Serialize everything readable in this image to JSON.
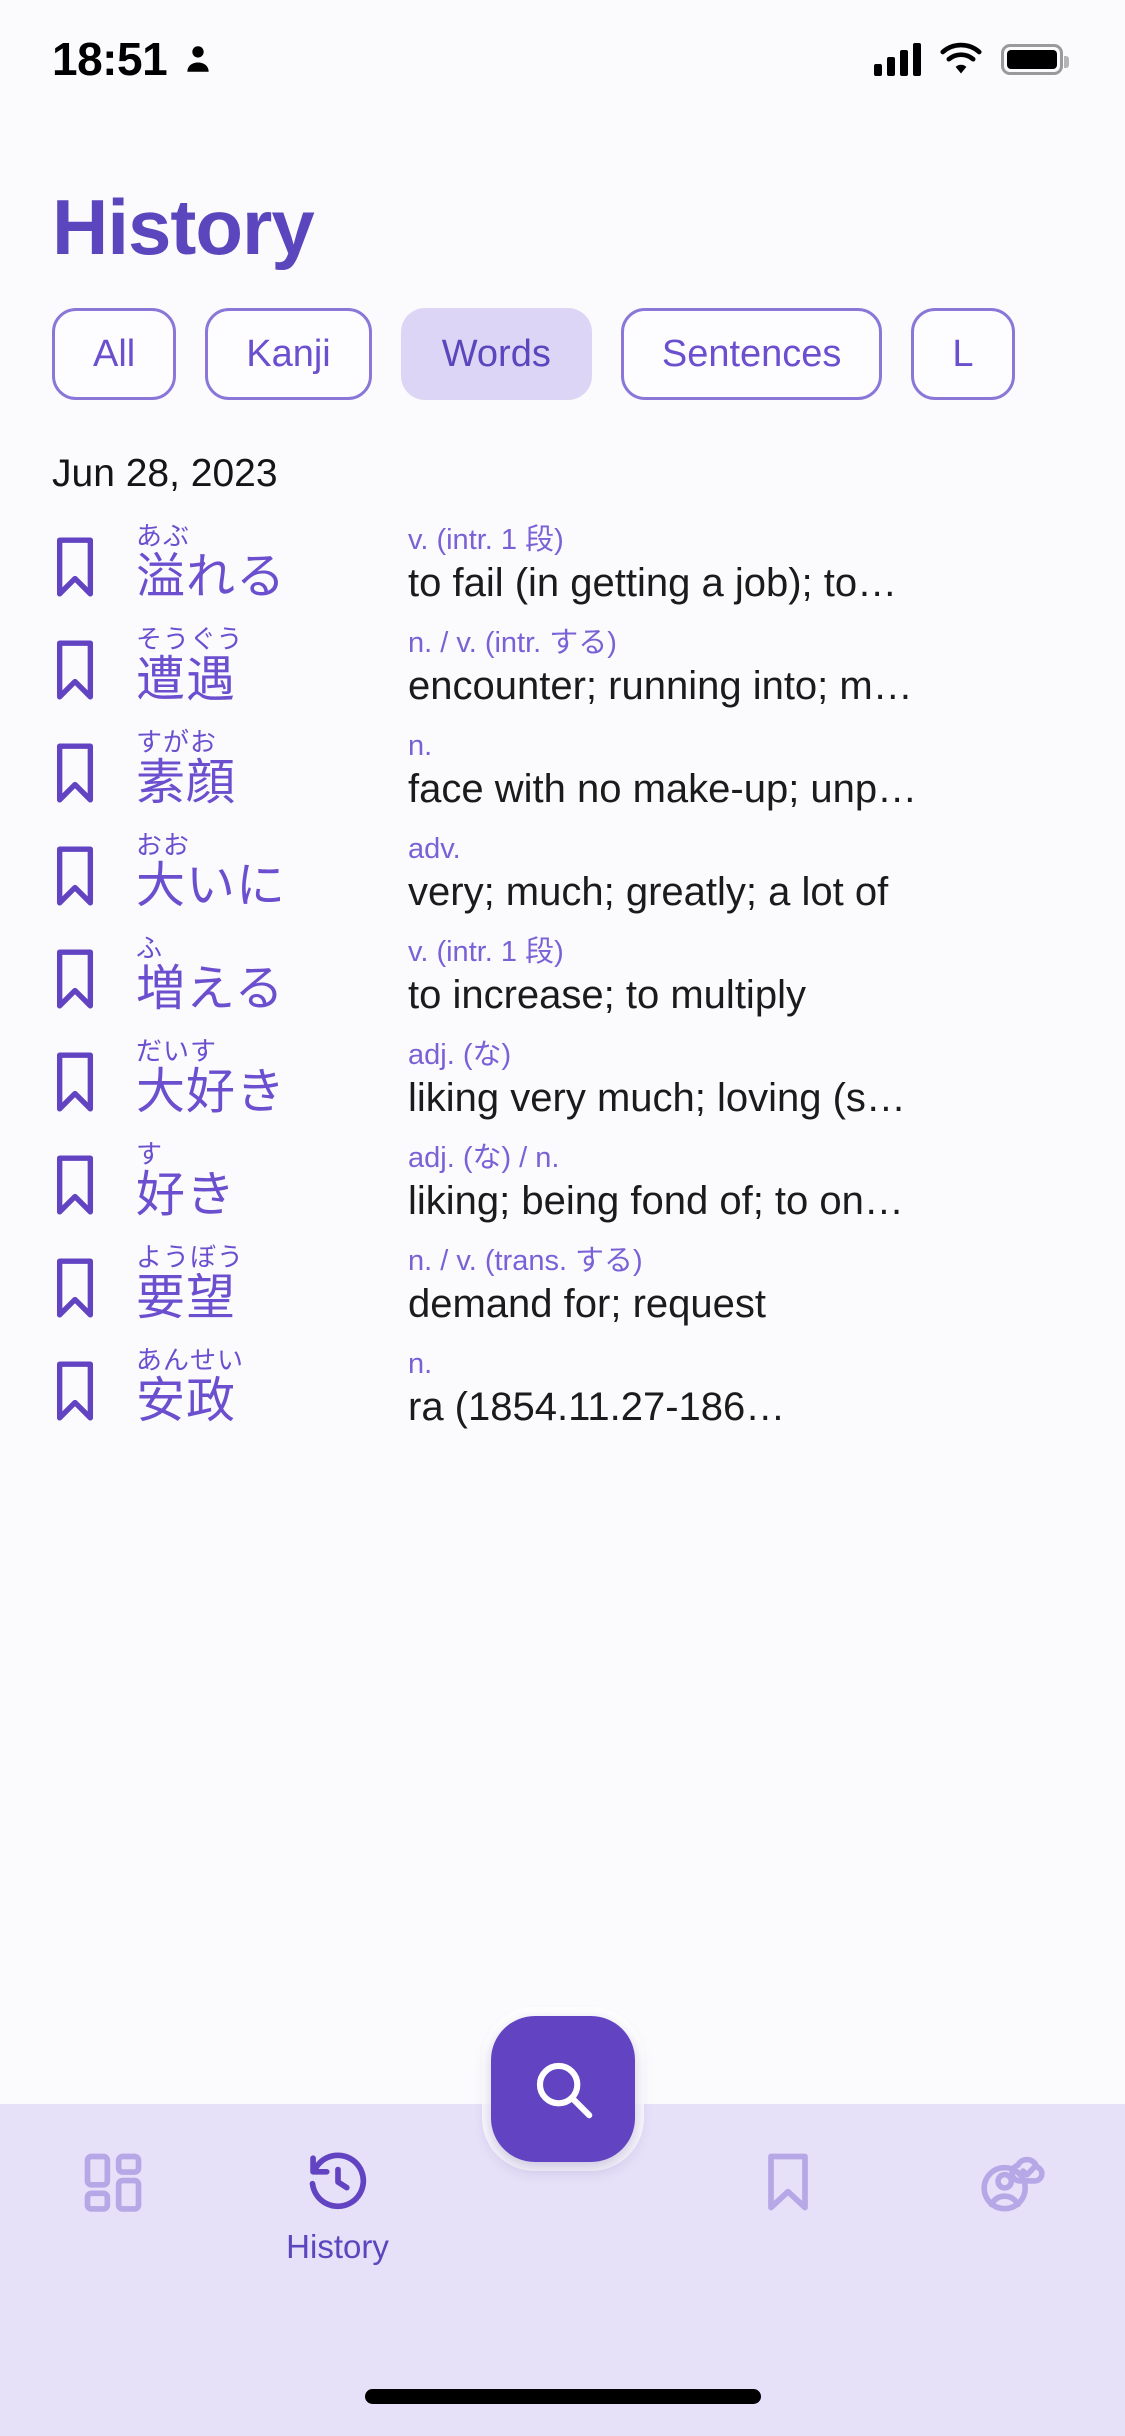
{
  "status_bar": {
    "time": "18:51",
    "person_icon": "person-icon",
    "signal_icon": "cellular-signal-icon",
    "wifi_icon": "wifi-icon",
    "battery_icon": "battery-full-icon"
  },
  "header": {
    "title": "History"
  },
  "filters": {
    "items": [
      {
        "label": "All",
        "active": false
      },
      {
        "label": "Kanji",
        "active": false
      },
      {
        "label": "Words",
        "active": true
      },
      {
        "label": "Sentences",
        "active": false
      },
      {
        "label": "L",
        "active": false
      }
    ]
  },
  "list": {
    "date_header": "Jun 28, 2023",
    "entries": [
      {
        "bookmark_icon": "bookmark-outline-icon",
        "furigana": "あぶ",
        "word": "溢れる",
        "pos": "v. (intr. 1 段)",
        "definition": "to fail (in getting a job); to…"
      },
      {
        "bookmark_icon": "bookmark-outline-icon",
        "furigana": "そうぐう",
        "word": "遭遇",
        "pos": "n. / v. (intr. する)",
        "definition": "encounter; running into; m…"
      },
      {
        "bookmark_icon": "bookmark-outline-icon",
        "furigana": "すがお",
        "word": "素顔",
        "pos": "n.",
        "definition": "face with no make-up; unp…"
      },
      {
        "bookmark_icon": "bookmark-outline-icon",
        "furigana": "おお",
        "word": "大いに",
        "pos": "adv.",
        "definition": "very; much; greatly; a lot of"
      },
      {
        "bookmark_icon": "bookmark-outline-icon",
        "furigana": "ふ",
        "word": "増える",
        "pos": "v. (intr. 1 段)",
        "definition": "to increase; to multiply"
      },
      {
        "bookmark_icon": "bookmark-outline-icon",
        "furigana": "だいす",
        "word": "大好き",
        "pos": "adj. (な)",
        "definition": "liking very much; loving (s…"
      },
      {
        "bookmark_icon": "bookmark-outline-icon",
        "furigana": "す",
        "word": "好き",
        "pos": "adj. (な) / n.",
        "definition": "liking; being fond of; to on…"
      },
      {
        "bookmark_icon": "bookmark-outline-icon",
        "furigana": "ようぼう",
        "word": "要望",
        "pos": "n. / v. (trans. する)",
        "definition": "demand for; request"
      },
      {
        "bookmark_icon": "bookmark-outline-icon",
        "furigana": "あんせい",
        "word": "安政",
        "pos": "n.",
        "definition": "ra (1854.11.27-186…"
      }
    ]
  },
  "fab": {
    "icon": "search-icon"
  },
  "bottom_nav": {
    "items": [
      {
        "icon": "dashboard-grid-icon",
        "label": "",
        "active": false
      },
      {
        "icon": "history-clock-icon",
        "label": "History",
        "active": true
      },
      {
        "icon": "bookmark-outline-icon",
        "label": "",
        "active": false
      },
      {
        "icon": "account-cloud-sync-icon",
        "label": "",
        "active": false
      }
    ]
  },
  "colors": {
    "accent": "#6244c2",
    "accent_text": "#6b4fcf",
    "chip_active_bg": "#ddd5f5",
    "bottom_bar_bg": "#e6e0f8",
    "page_bg": "#fbfbfd",
    "inactive_icon": "#b6a7e6"
  }
}
